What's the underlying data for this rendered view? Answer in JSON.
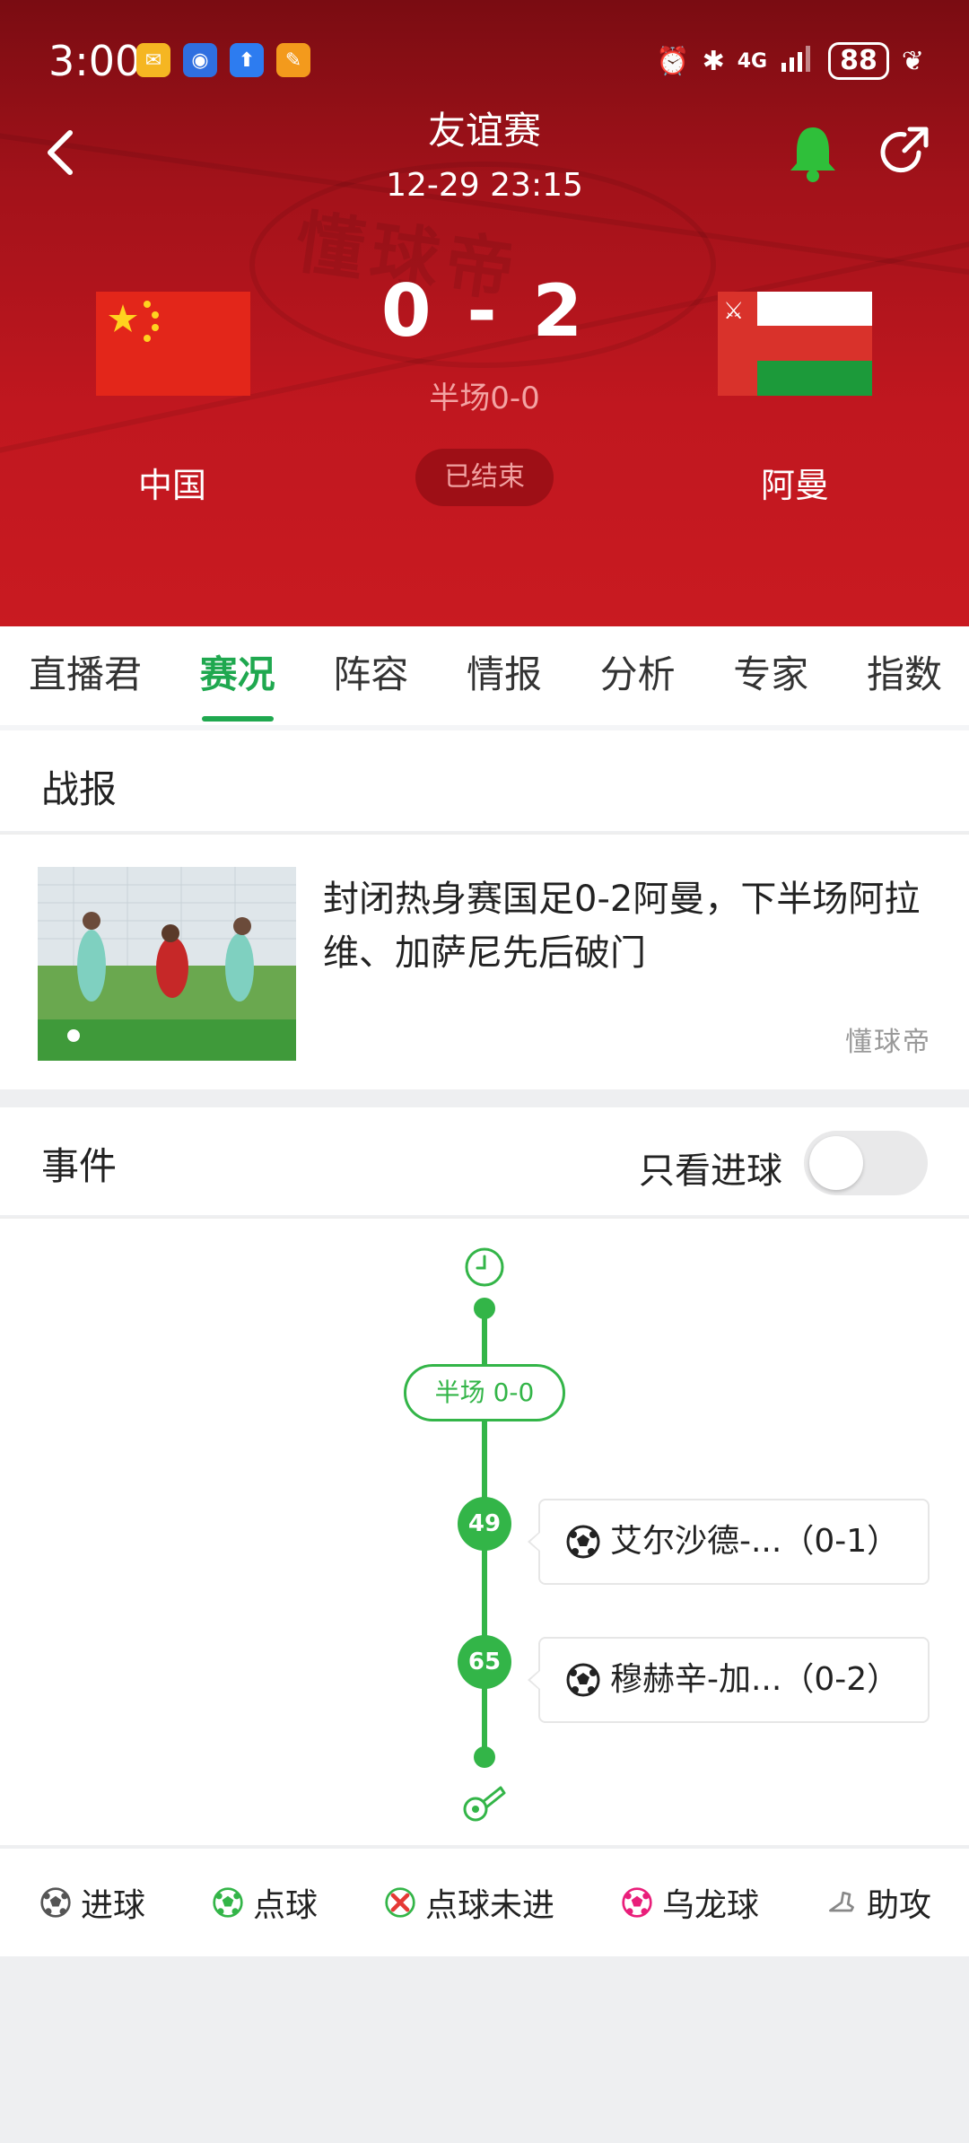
{
  "status_bar": {
    "time": "3:00",
    "network": "4G",
    "battery": "88"
  },
  "match": {
    "type": "友谊赛",
    "datetime": "12-29 23:15",
    "score": "0 - 2",
    "halftime": "半场0-0",
    "status": "已结束",
    "home_team": "中国",
    "away_team": "阿曼",
    "watermark": "懂球帝"
  },
  "tabs": [
    {
      "label": "直播君",
      "active": false
    },
    {
      "label": "赛况",
      "active": true
    },
    {
      "label": "阵容",
      "active": false
    },
    {
      "label": "情报",
      "active": false
    },
    {
      "label": "分析",
      "active": false
    },
    {
      "label": "专家",
      "active": false
    },
    {
      "label": "指数",
      "active": false
    }
  ],
  "report": {
    "section_title": "战报",
    "headline": "封闭热身赛国足0-2阿曼，下半场阿拉维、加萨尼先后破门",
    "source_logo": "懂球帝"
  },
  "events": {
    "section_title": "事件",
    "toggle_label": "只看进球",
    "toggle_on": false,
    "halftime_label": "半场 0-0",
    "items": [
      {
        "minute": "49",
        "icon": "goal-icon",
        "text": "艾尔沙德-...（0-1）"
      },
      {
        "minute": "65",
        "icon": "goal-icon",
        "text": "穆赫辛-加...（0-2）"
      }
    ]
  },
  "legend": [
    {
      "icon": "goal-icon",
      "label": "进球",
      "color": "#333333"
    },
    {
      "icon": "penalty-icon",
      "label": "点球",
      "color": "#33b548"
    },
    {
      "icon": "penalty-missed-icon",
      "label": "点球未进",
      "color": "#e53935"
    },
    {
      "icon": "own-goal-icon",
      "label": "乌龙球",
      "color": "#e91e7a"
    },
    {
      "icon": "assist-icon",
      "label": "助攻",
      "color": "#888888"
    }
  ],
  "colors": {
    "accent": "#1fa84f",
    "header_red": "#c0171f",
    "timeline_green": "#33b548"
  }
}
